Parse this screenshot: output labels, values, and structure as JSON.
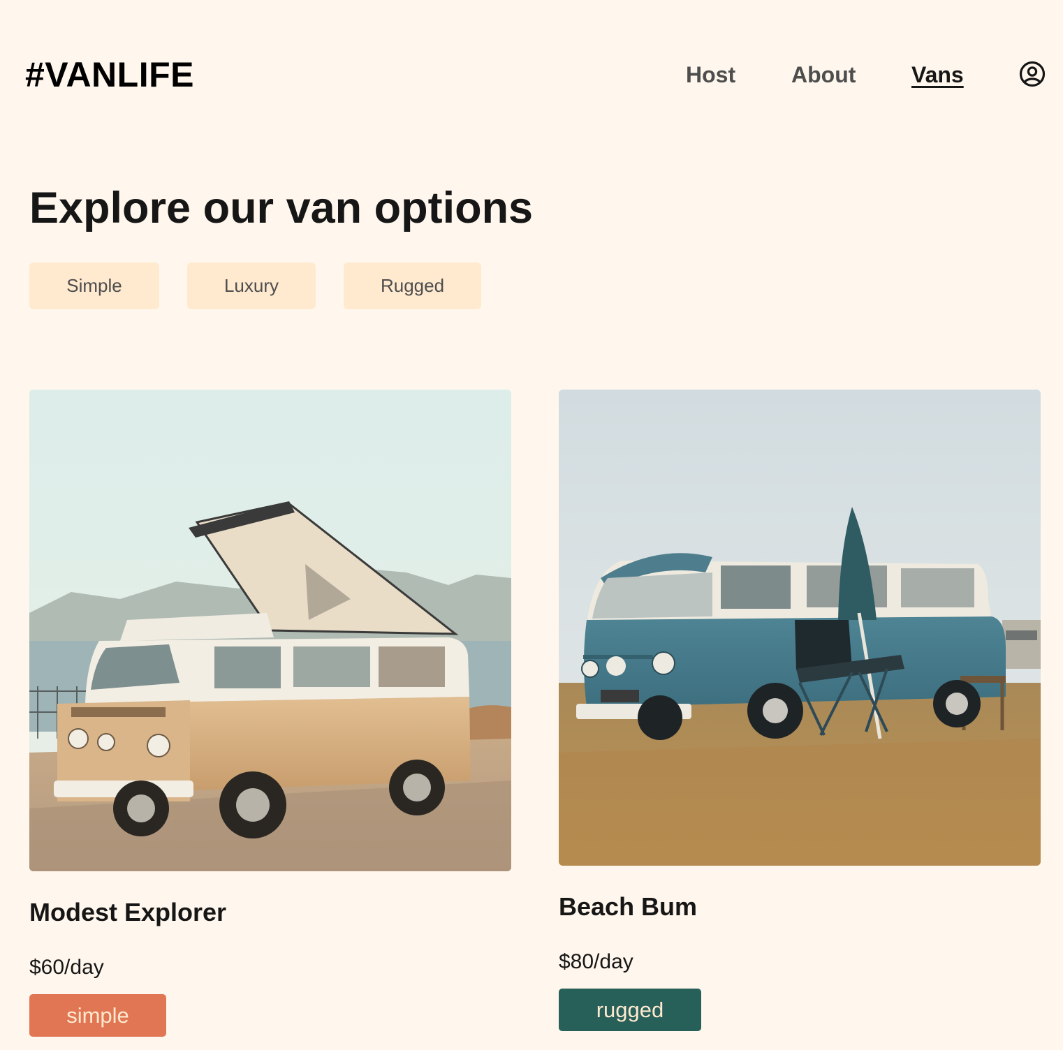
{
  "header": {
    "logo": "#VANLIFE",
    "nav": [
      {
        "label": "Host",
        "active": false
      },
      {
        "label": "About",
        "active": false
      },
      {
        "label": "Vans",
        "active": true
      }
    ],
    "user_icon": "user-circle-icon"
  },
  "main": {
    "title": "Explore our van options",
    "filters": [
      "Simple",
      "Luxury",
      "Rugged"
    ],
    "vans": [
      {
        "name": "Modest Explorer",
        "price": "$60/day",
        "type": "simple",
        "type_color": "#E17654",
        "image": "beige camper van with pop-up roof by the sea"
      },
      {
        "name": "Beach Bum",
        "price": "$80/day",
        "type": "rugged",
        "type_color": "#115E59",
        "image": "teal and white van with camping chair on dry grass"
      }
    ]
  },
  "colors": {
    "background": "#FFF7ED",
    "filter_bg": "#FFEAD0",
    "simple": "#E17654",
    "rugged": "#115E59"
  }
}
